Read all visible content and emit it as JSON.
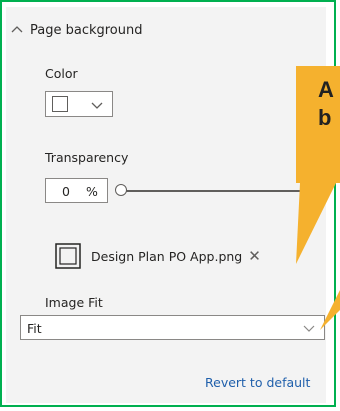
{
  "section": {
    "title": "Page background"
  },
  "color": {
    "label": "Color",
    "value": "#ffffff"
  },
  "transparency": {
    "label": "Transparency",
    "value": "0",
    "unit": "%",
    "slider_fraction": 0
  },
  "image": {
    "filename": "Design Plan PO App.png",
    "remove_icon": "close-icon"
  },
  "image_fit": {
    "label": "Image Fit",
    "selected": "Fit"
  },
  "revert": {
    "label": "Revert to default"
  },
  "callout": {
    "line1": "A",
    "line2": "b",
    "color": "#f5b12e"
  },
  "colors": {
    "accent_border": "#00b050",
    "link": "#1f5fab"
  }
}
